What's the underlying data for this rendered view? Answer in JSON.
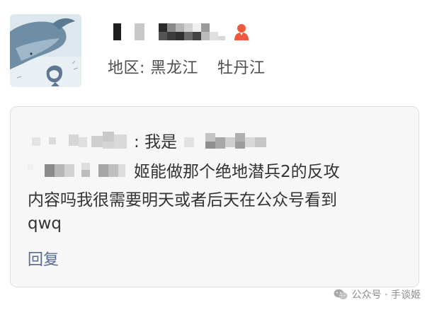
{
  "profile": {
    "region_label": "地区:",
    "province": "黑龙江",
    "city": "牡丹江",
    "name_icon": "person-icon",
    "name_icon_color": "#f05a3c"
  },
  "message": {
    "line1_text": ": 我是",
    "line2_text": "姬能做那个绝地潜兵2的反攻",
    "line3_text": "内容吗我很需要明天或者后天在公众号看到",
    "line4_text": "qwq",
    "reply_label": "回复",
    "reply_color": "#576b95"
  },
  "watermark": {
    "icon": "wechat-icon",
    "text": "公众号 · 手谈姬"
  }
}
